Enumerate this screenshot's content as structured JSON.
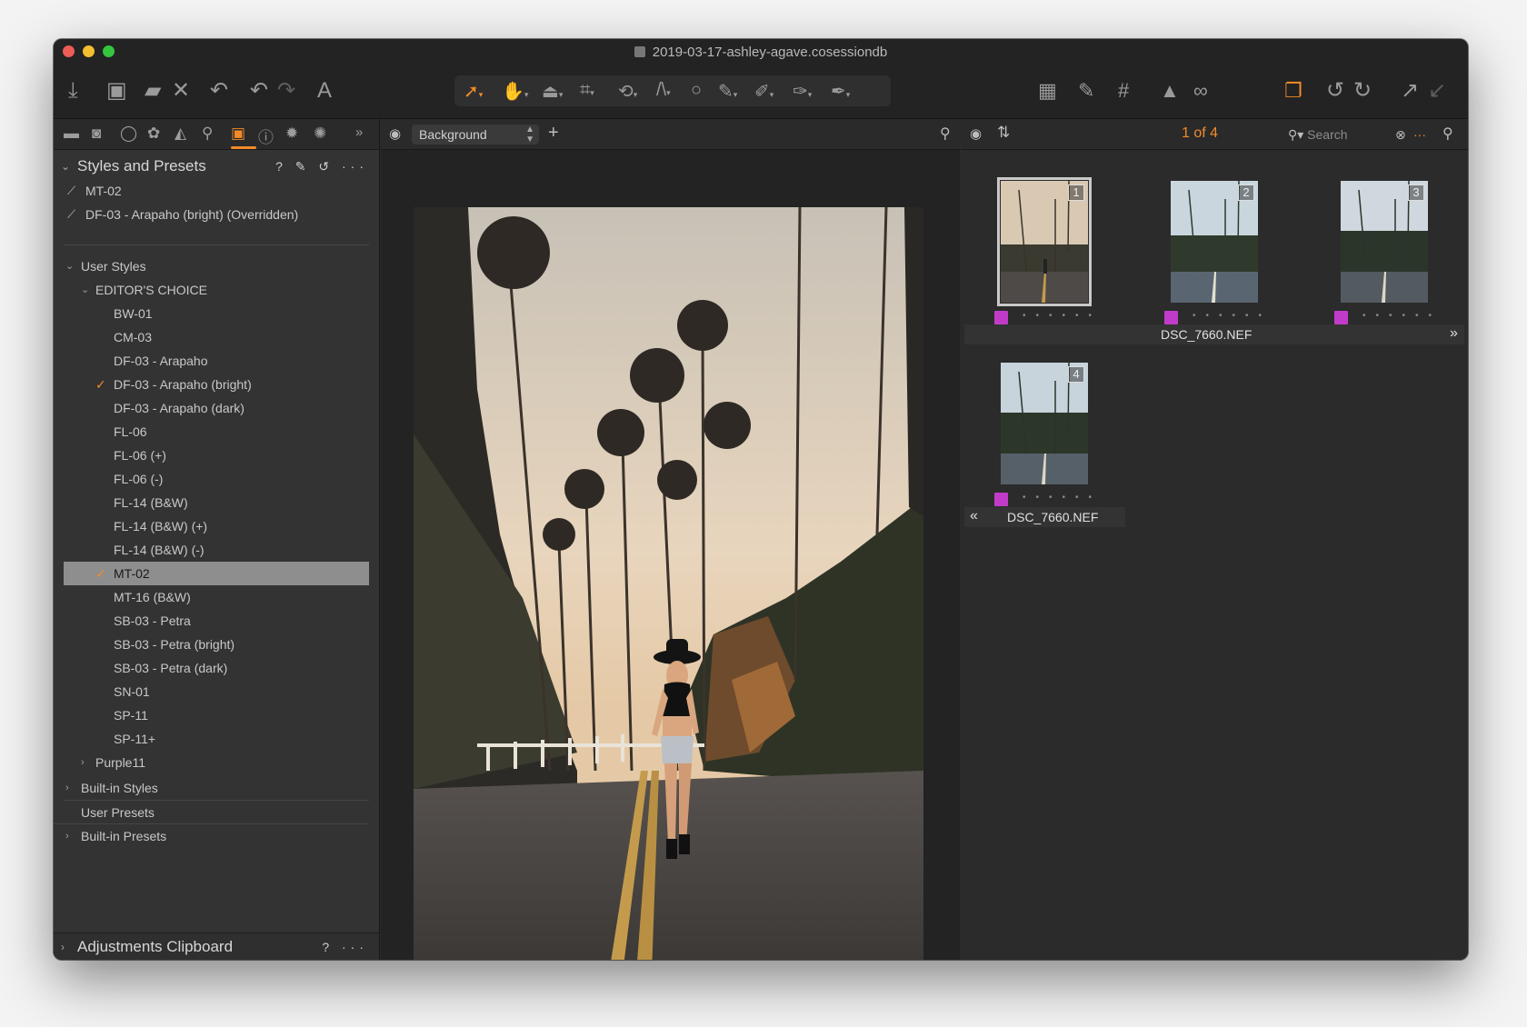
{
  "window": {
    "title": "2019-03-17-ashley-agave.cosessiondb",
    "traffic_colors": [
      "#ee5c56",
      "#f3bf2f",
      "#35c640"
    ]
  },
  "toolbar": {
    "left_icons": [
      "import-icon",
      "camera-icon",
      "folder-move-icon",
      "delete-icon",
      "undo-icon",
      "undo-back-icon",
      "redo-icon",
      "text-icon"
    ],
    "cursor_tools": [
      "select-cursor-icon",
      "pan-icon",
      "loupe-icon",
      "crop-icon",
      "rotate-icon",
      "keystone-icon",
      "spot-icon",
      "brush-icon",
      "eraser-icon",
      "gradient-icon",
      "picker-icon"
    ],
    "right_icons": [
      "grid-icon",
      "edit-icon",
      "overlay-grid-icon",
      "warning-icon",
      "glasses-icon",
      "variants-icon",
      "rotate-left-icon",
      "rotate-right-icon",
      "export-icon",
      "import-in-icon"
    ]
  },
  "left_panel": {
    "tabs": [
      "library-tab",
      "capture-tab",
      "lens-tab",
      "color-tab",
      "exposure-tab",
      "details-tab",
      "adjustments-tab",
      "metadata-tab",
      "output-tab",
      "batch-tab"
    ],
    "panel_title": "Styles and Presets",
    "panel_controls": "? ✎ ↺ ···",
    "applied": [
      "MT-02",
      "DF-03 - Arapaho (bright) (Overridden)"
    ],
    "user_styles_label": "User Styles",
    "editors_choice_label": "EDITOR'S CHOICE",
    "styles": [
      {
        "label": "BW-01",
        "checked": false,
        "selected": false
      },
      {
        "label": "CM-03",
        "checked": false,
        "selected": false
      },
      {
        "label": "DF-03 - Arapaho",
        "checked": false,
        "selected": false
      },
      {
        "label": "DF-03 - Arapaho (bright)",
        "checked": true,
        "selected": false
      },
      {
        "label": "DF-03 - Arapaho (dark)",
        "checked": false,
        "selected": false
      },
      {
        "label": "FL-06",
        "checked": false,
        "selected": false
      },
      {
        "label": "FL-06 (+)",
        "checked": false,
        "selected": false
      },
      {
        "label": "FL-06 (-)",
        "checked": false,
        "selected": false
      },
      {
        "label": "FL-14 (B&W)",
        "checked": false,
        "selected": false
      },
      {
        "label": "FL-14 (B&W) (+)",
        "checked": false,
        "selected": false
      },
      {
        "label": "FL-14 (B&W) (-)",
        "checked": false,
        "selected": false
      },
      {
        "label": "MT-02",
        "checked": true,
        "selected": true
      },
      {
        "label": "MT-16 (B&W)",
        "checked": false,
        "selected": false
      },
      {
        "label": "SB-03 - Petra",
        "checked": false,
        "selected": false
      },
      {
        "label": "SB-03 - Petra (bright)",
        "checked": false,
        "selected": false
      },
      {
        "label": "SB-03 - Petra (dark)",
        "checked": false,
        "selected": false
      },
      {
        "label": "SN-01",
        "checked": false,
        "selected": false
      },
      {
        "label": "SP-11",
        "checked": false,
        "selected": false
      },
      {
        "label": "SP-11+",
        "checked": false,
        "selected": false
      }
    ],
    "purple_label": "Purple11",
    "builtin_styles_label": "Built-in Styles",
    "user_presets_label": "User Presets",
    "builtin_presets_label": "Built-in Presets",
    "footer_title": "Adjustments Clipboard",
    "footer_controls": "? ···"
  },
  "viewer": {
    "layer": "Background"
  },
  "browser": {
    "counter": "1 of 4",
    "search_placeholder": "Search",
    "thumbnails": [
      {
        "number": "1",
        "selected": true
      },
      {
        "number": "2",
        "selected": false
      },
      {
        "number": "3",
        "selected": false
      },
      {
        "number": "4",
        "selected": false
      }
    ],
    "filename_row1": "DSC_7660.NEF",
    "filename_row2": "DSC_7660.NEF",
    "color_tag": "#c03cc8",
    "accent": "#f28a2a"
  }
}
